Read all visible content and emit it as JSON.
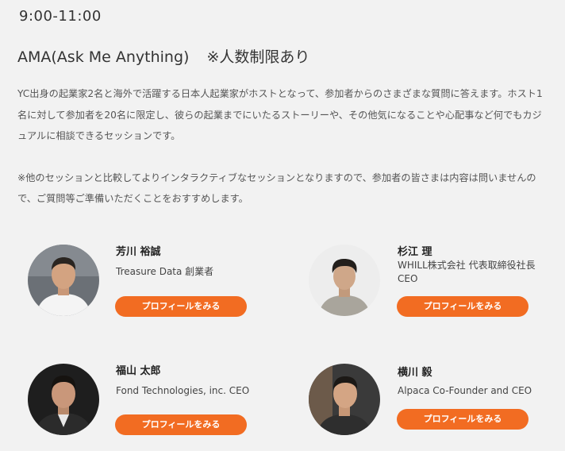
{
  "session": {
    "time": "9:00-11:00",
    "title": "AMA(Ask Me Anything)",
    "limit_note": "※人数制限あり",
    "description": [
      "YC出身の起業家2名と海外で活躍する日本人起業家がホストとなって、参加者からのさまざまな質問に答えます。ホスト1名に対して参加者を20名に限定し、彼らの起業までにいたるストーリーや、その他気になることや心配事など何でもカジュアルに相談できるセッションです。",
      "※他のセッションと比較してよりインタラクティブなセッションとなりますので、参加者の皆さまは内容は問いませんので、ご質問等ご準備いただくことをおすすめします。"
    ]
  },
  "hosts": [
    {
      "name": "芳川 裕誠",
      "role": "Treasure Data 創業者",
      "button": "プロフィールをみる"
    },
    {
      "name": "杉江 理",
      "role": "WHILL株式会社 代表取締役社長 CEO",
      "button": "プロフィールをみる"
    },
    {
      "name": "福山 太郎",
      "role": "Fond Technologies, inc. CEO",
      "button": "プロフィールをみる"
    },
    {
      "name": "横川 毅",
      "role": "Alpaca Co-Founder and CEO",
      "button": "プロフィールをみる"
    }
  ],
  "colors": {
    "accent": "#f26c22",
    "background": "#f2f2f2",
    "text": "#333333"
  }
}
